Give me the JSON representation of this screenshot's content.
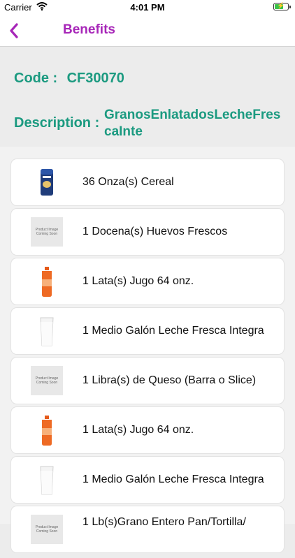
{
  "status": {
    "carrier": "Carrier",
    "time": "4:01 PM"
  },
  "nav": {
    "title": "Benefits"
  },
  "info": {
    "code_label": "Code :",
    "code_value": "CF30070",
    "description_label": "Description :",
    "description_value": "GranosEnlatadosLecheFrescaInte"
  },
  "placeholder": {
    "line1": "Product Image",
    "line2": "Coming Soon"
  },
  "items": [
    {
      "label": "36 Onza(s) Cereal",
      "image": "cereal-box"
    },
    {
      "label": "1 Docena(s) Huevos Frescos",
      "image": "placeholder"
    },
    {
      "label": "1 Lata(s) Jugo 64 onz.",
      "image": "juice-bottle"
    },
    {
      "label": "1 Medio Galón Leche Fresca Integra",
      "image": "milk-glass"
    },
    {
      "label": "1 Libra(s) de Queso (Barra o Slice)",
      "image": "placeholder"
    },
    {
      "label": "1 Lata(s) Jugo 64 onz.",
      "image": "juice-bottle"
    },
    {
      "label": "1 Medio Galón Leche Fresca Integra",
      "image": "milk-glass"
    },
    {
      "label": "1 Lb(s)Grano Entero Pan/Tortilla/",
      "image": "placeholder"
    }
  ],
  "colors": {
    "accent": "#a726b8",
    "teal": "#1b9a80"
  }
}
